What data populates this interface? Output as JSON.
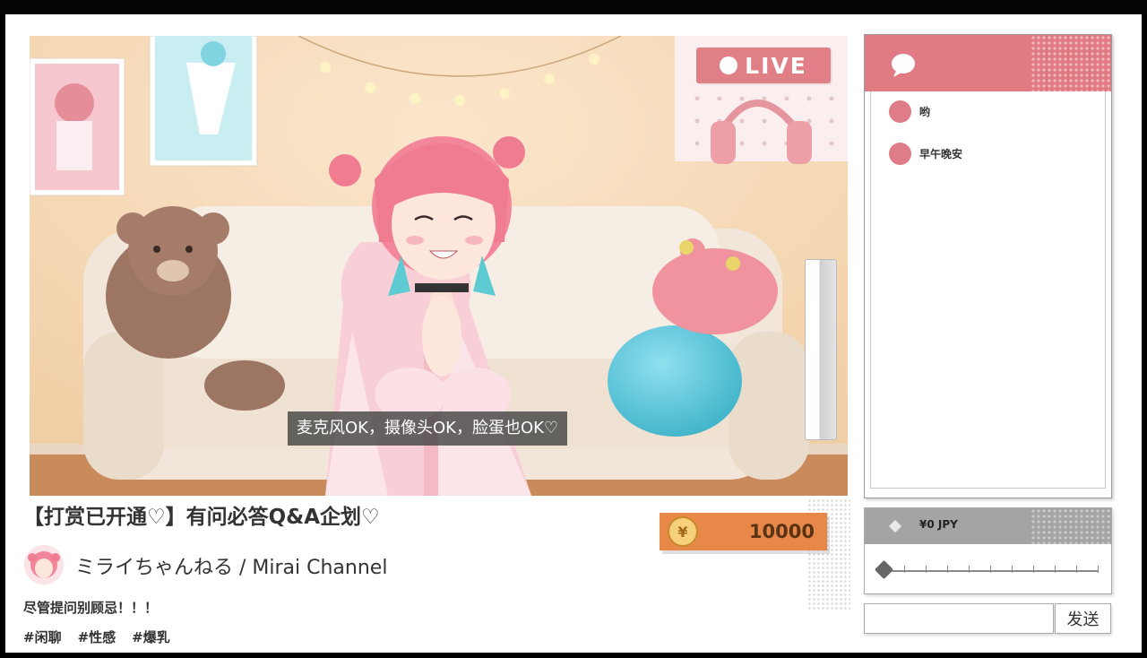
{
  "stream": {
    "live_label": "LIVE",
    "subtitle": "麦克风OK，摄像头OK，脸蛋也OK♡",
    "title": "【打赏已开通♡】有问必答Q&A企划♡",
    "channel_name": "ミライちゃんねる / Mirai Channel",
    "description": "尽管提问别顾忌！！！",
    "tags": [
      "#闲聊",
      "#性感",
      "#爆乳"
    ]
  },
  "coins": {
    "icon": "yen-coin-icon",
    "symbol": "¥",
    "count": "10000"
  },
  "chat": {
    "icon": "speech-bubble-icon",
    "messages": [
      {
        "text": "哟"
      },
      {
        "text": "早午晚安"
      }
    ]
  },
  "tip": {
    "amount_label": "¥0 JPY",
    "slider_value": 0
  },
  "send": {
    "input_value": "",
    "button_label": "发送"
  },
  "colors": {
    "accent_pink": "#e17b83",
    "coin_orange": "#e88848",
    "panel_gray": "#a4a4a4"
  }
}
